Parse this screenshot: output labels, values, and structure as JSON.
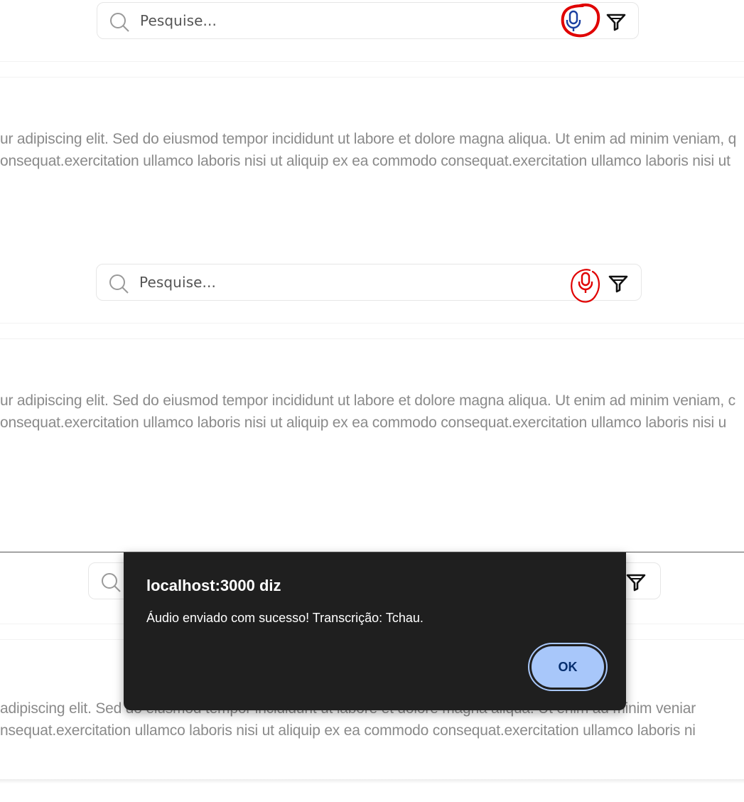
{
  "search": {
    "placeholder": "Pesquise..."
  },
  "sections": [
    {
      "line1": "ur adipiscing elit. Sed do eiusmod tempor incididunt ut labore et dolore magna aliqua. Ut enim ad minim veniam, q",
      "line2": "onsequat.exercitation ullamco laboris nisi ut aliquip ex ea commodo consequat.exercitation ullamco laboris nisi ut"
    },
    {
      "line1": "ur adipiscing elit. Sed do eiusmod tempor incididunt ut labore et dolore magna aliqua. Ut enim ad minim veniam, c",
      "line2": "onsequat.exercitation ullamco laboris nisi ut aliquip ex ea commodo consequat.exercitation ullamco laboris nisi u"
    },
    {
      "line1": "adipiscing elit. Sed do eiusmod tempor incididunt ut labore et dolore magna aliqua. Ut enim ad minim veniar",
      "line2": "nsequat.exercitation ullamco laboris nisi ut aliquip ex ea commodo consequat.exercitation ullamco laboris ni"
    }
  ],
  "dialog": {
    "title": "localhost:3000 diz",
    "message": "Áudio enviado com sucesso! Transcrição: Tchau.",
    "ok_label": "OK"
  },
  "colors": {
    "mic_icon": "#1a3fa0",
    "annotation": "#e00000",
    "ok_button": "#a8c7fa",
    "dialog_bg": "#1f1f1f"
  },
  "icons": [
    "search-icon",
    "microphone-icon",
    "filter-icon"
  ]
}
